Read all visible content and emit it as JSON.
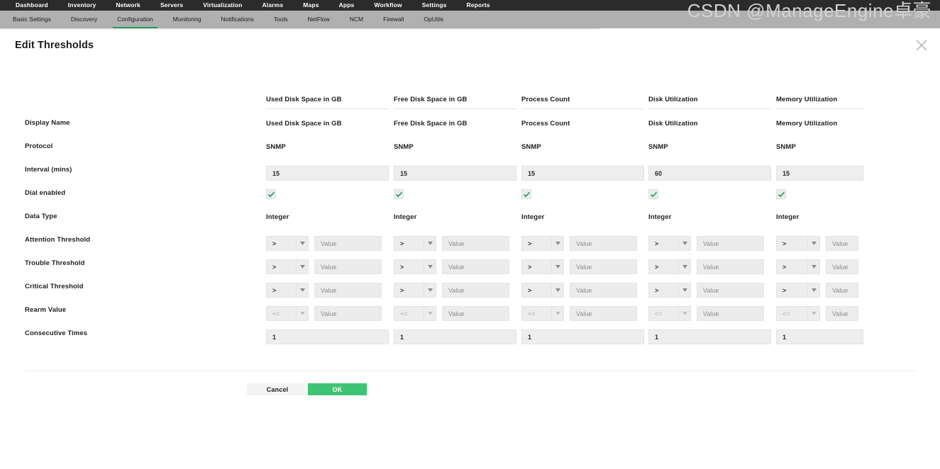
{
  "topnav": {
    "items": [
      {
        "label": "Dashboard"
      },
      {
        "label": "Inventory"
      },
      {
        "label": "Network"
      },
      {
        "label": "Servers"
      },
      {
        "label": "Virtualization"
      },
      {
        "label": "Alarms"
      },
      {
        "label": "Maps"
      },
      {
        "label": "Apps"
      },
      {
        "label": "Workflow"
      },
      {
        "label": "Settings"
      },
      {
        "label": "Reports"
      }
    ]
  },
  "subnav": {
    "active": "Configuration",
    "items": [
      {
        "label": "Basic Settings"
      },
      {
        "label": "Discovery"
      },
      {
        "label": "Configuration"
      },
      {
        "label": "Monitoring"
      },
      {
        "label": "Notifications"
      },
      {
        "label": "Tools"
      },
      {
        "label": "NetFlow"
      },
      {
        "label": "NCM"
      },
      {
        "label": "Firewall"
      },
      {
        "label": "OpUtils"
      }
    ]
  },
  "dialog": {
    "title": "Edit Thresholds",
    "close_icon": "close-icon"
  },
  "row_labels": {
    "display_name": "Display Name",
    "protocol": "Protocol",
    "interval": "Interval (mins)",
    "dial_enabled": "Dial enabled",
    "data_type": "Data Type",
    "attention_threshold": "Attention Threshold",
    "trouble_threshold": "Trouble Threshold",
    "critical_threshold": "Critical Threshold",
    "rearm_value": "Rearm Value",
    "consecutive_times": "Consecutive Times"
  },
  "value_placeholder": "Value",
  "columns": [
    {
      "header": "Used Disk Space in GB",
      "display_name": "Used Disk Space in GB",
      "protocol": "SNMP",
      "interval": "15",
      "dial_enabled": true,
      "data_type": "Integer",
      "attention_op": ">",
      "attention_value": "",
      "trouble_op": ">",
      "trouble_value": "",
      "critical_op": ">",
      "critical_value": "",
      "rearm_op": "<=",
      "rearm_value": "",
      "consecutive_times": "1"
    },
    {
      "header": "Free Disk Space in GB",
      "display_name": "Free Disk Space in GB",
      "protocol": "SNMP",
      "interval": "15",
      "dial_enabled": true,
      "data_type": "Integer",
      "attention_op": ">",
      "attention_value": "",
      "trouble_op": ">",
      "trouble_value": "",
      "critical_op": ">",
      "critical_value": "",
      "rearm_op": "<=",
      "rearm_value": "",
      "consecutive_times": "1"
    },
    {
      "header": "Process Count",
      "display_name": "Process Count",
      "protocol": "SNMP",
      "interval": "15",
      "dial_enabled": true,
      "data_type": "Integer",
      "attention_op": ">",
      "attention_value": "",
      "trouble_op": ">",
      "trouble_value": "",
      "critical_op": ">",
      "critical_value": "",
      "rearm_op": "<=",
      "rearm_value": "",
      "consecutive_times": "1"
    },
    {
      "header": "Disk Utilization",
      "display_name": "Disk Utilization",
      "protocol": "SNMP",
      "interval": "60",
      "dial_enabled": true,
      "data_type": "Integer",
      "attention_op": ">",
      "attention_value": "",
      "trouble_op": ">",
      "trouble_value": "",
      "critical_op": ">",
      "critical_value": "",
      "rearm_op": "<=",
      "rearm_value": "",
      "consecutive_times": "1"
    },
    {
      "header": "Memory Utilization",
      "display_name": "Memory Utilization",
      "protocol": "SNMP",
      "interval": "15",
      "dial_enabled": true,
      "data_type": "Integer",
      "attention_op": ">",
      "attention_value": "",
      "trouble_op": ">",
      "trouble_value": "",
      "critical_op": ">",
      "critical_value": "",
      "rearm_op": "<=",
      "rearm_value": "",
      "consecutive_times": "1"
    }
  ],
  "buttons": {
    "cancel": "Cancel",
    "ok": "OK"
  },
  "watermark": "CSDN @ManageEngine卓豪",
  "colors": {
    "accent_green": "#3ec474",
    "nav_dark": "#2b2b2b",
    "subnav_gray": "#b0b0b0",
    "check_green": "#18a558"
  }
}
